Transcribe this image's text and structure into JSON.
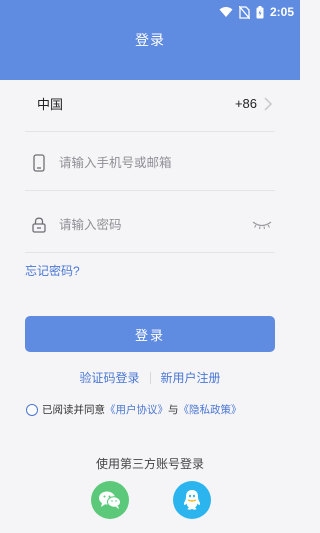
{
  "status": {
    "time": "2:05"
  },
  "header": {
    "title": "登录"
  },
  "country": {
    "name": "中国",
    "code": "+86"
  },
  "phone": {
    "placeholder": "请输入手机号或邮箱"
  },
  "password": {
    "placeholder": "请输入密码"
  },
  "forgot_label": "忘记密码?",
  "login_label": "登录",
  "links": {
    "sms_login": "验证码登录",
    "register": "新用户注册"
  },
  "agreement": {
    "prefix": "已阅读并同意",
    "user_agreement": "《用户协议》",
    "and": "与",
    "privacy_policy": "《隐私政策》"
  },
  "third_party": {
    "title": "使用第三方账号登录",
    "providers": [
      "wechat-icon",
      "qq-icon"
    ]
  },
  "colors": {
    "primary": "#5f8be0",
    "link": "#4a77d4",
    "wechat": "#5cc97a",
    "qq": "#2bb4ee"
  }
}
